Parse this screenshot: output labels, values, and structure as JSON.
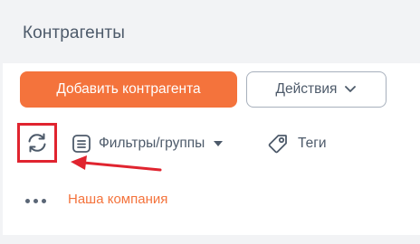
{
  "header": {
    "title": "Контрагенты"
  },
  "toolbar": {
    "add_label": "Добавить контрагента",
    "actions_label": "Действия",
    "filters_label": "Фильтры/группы",
    "tags_label": "Теги"
  },
  "list": {
    "items": [
      {
        "name": "Наша компания"
      }
    ]
  },
  "colors": {
    "accent": "#f4733c",
    "highlight": "#e0242f",
    "text": "#4d5a6a",
    "background": "#f2f3f5"
  },
  "icons": [
    "refresh-icon",
    "list-icon",
    "caret-down-icon",
    "tag-icon",
    "chevron-down-icon",
    "more-dots-icon"
  ]
}
